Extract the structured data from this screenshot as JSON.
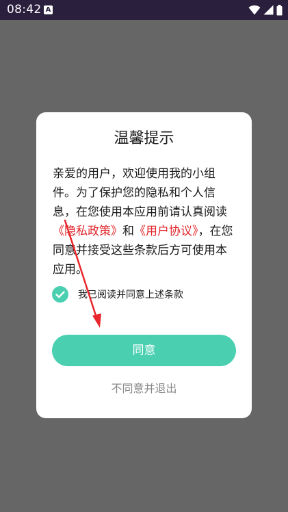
{
  "status_bar": {
    "time": "08:42",
    "notification_icon": "A",
    "icons": [
      "wifi-icon",
      "signal-icon",
      "battery-icon"
    ]
  },
  "dialog": {
    "title": "温馨提示",
    "body_prefix": "亲爱的用户，欢迎使用我的小组件。为了保护您的隐私和个人信息，在您使用本应用前请认真阅读",
    "privacy_link": "《隐私政策》",
    "conjunction": "和",
    "user_agreement_link": "《用户协议》",
    "body_suffix": "，在您同意并接受这些条款后方可使用本应用。",
    "agree_checkbox_label": "我已阅读并同意上述条款",
    "agree_checked": true,
    "agree_button": "同意",
    "decline_button": "不同意并退出"
  },
  "colors": {
    "accent": "#4ad0b1",
    "link": "#e0262b",
    "overlay": "#666666",
    "status_bar": "#2a1f3d"
  }
}
